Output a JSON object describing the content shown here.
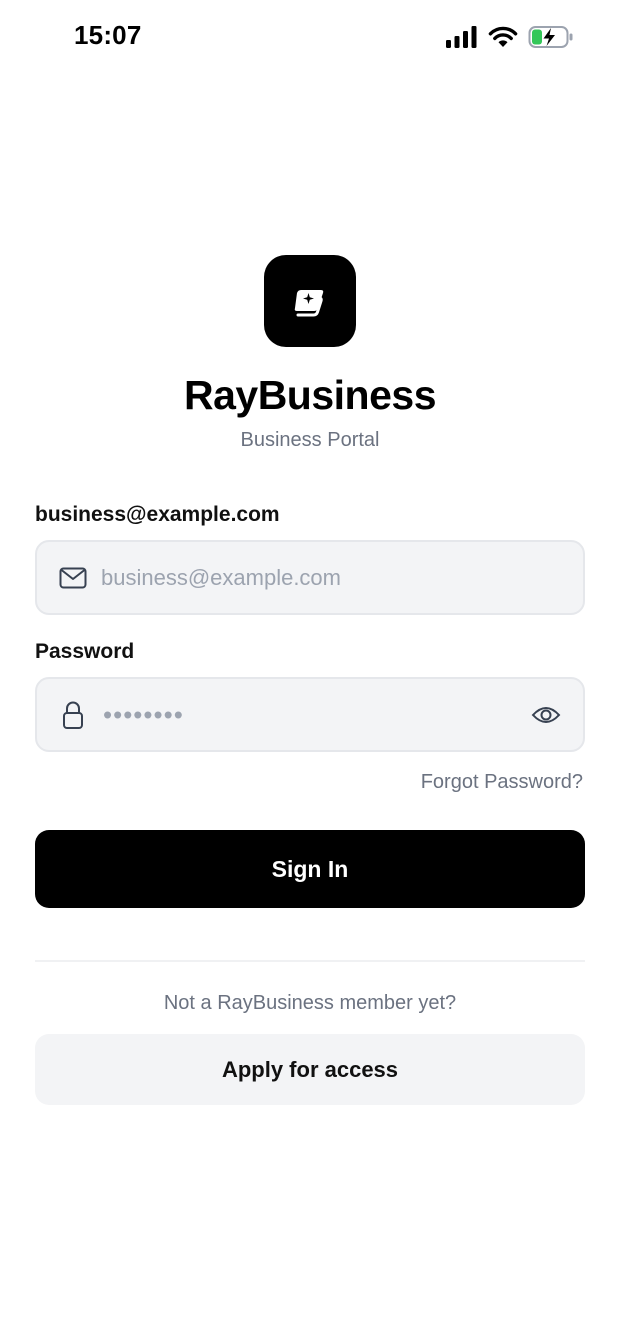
{
  "status_bar": {
    "time": "15:07",
    "icons": [
      "cellular-signal-icon",
      "wifi-icon",
      "battery-charging-icon"
    ],
    "battery_color": "#34c759"
  },
  "header": {
    "logo_icon": "sparkle-cards-icon",
    "title": "RayBusiness",
    "subtitle": "Business Portal"
  },
  "form": {
    "email": {
      "label": "business@example.com",
      "placeholder": "business@example.com",
      "value": "",
      "icon": "mail-icon"
    },
    "password": {
      "label": "Password",
      "masked_value": "••••••••",
      "icon": "lock-icon",
      "toggle_icon": "eye-icon"
    },
    "forgot_label": "Forgot Password?",
    "submit_label": "Sign In"
  },
  "footer": {
    "prompt": "Not a RayBusiness member yet?",
    "apply_label": "Apply for access"
  },
  "colors": {
    "primary": "#000000",
    "field_bg": "#f3f4f6",
    "field_border": "#e5e7eb",
    "muted_text": "#6b7280",
    "placeholder": "#9ca3af"
  }
}
